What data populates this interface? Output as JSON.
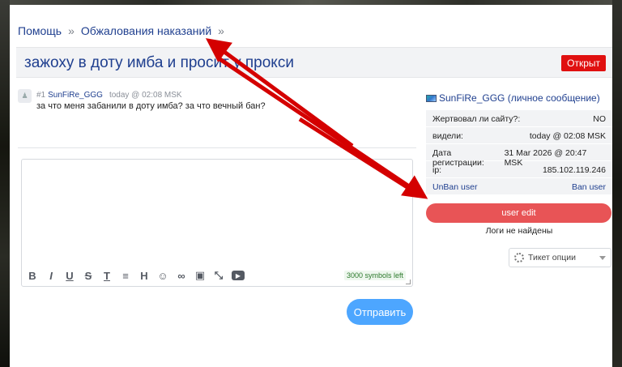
{
  "breadcrumb": {
    "home": "Помощь",
    "sep1": "»",
    "section": "Обжалования наказаний",
    "sep2": "»"
  },
  "thread": {
    "title": "зажоху в доту имба и просит у прокси",
    "status": "Открыт"
  },
  "post": {
    "number": "#1",
    "author": "SunFiRe_GGG",
    "time": "today @ 02:08 MSK",
    "text": "за что меня забанили в доту имба? за что вечный бан?"
  },
  "editor": {
    "counter": "3000 symbols left",
    "tools": [
      "B",
      "I",
      "U",
      "S",
      "T",
      "≡",
      "H",
      "☺",
      "∞",
      "▣",
      "⤡",
      "▶"
    ],
    "tool_icons": [
      "bold-icon",
      "italic-icon",
      "underline-icon",
      "strikethrough-icon",
      "text-clear-icon",
      "list-icon",
      "heading-icon",
      "emoji-icon",
      "link-icon",
      "image-icon",
      "collapse-icon",
      "video-icon"
    ]
  },
  "send_label": "Отправить",
  "sidebar": {
    "user": "SunFiRe_GGG (личное сообщение)",
    "rows": [
      {
        "label": "Жертвовал ли сайту?:",
        "value": "NO"
      },
      {
        "label": "видели:",
        "value": "today @ 02:08 MSK"
      },
      {
        "label": "Дата регистрации:",
        "value": "31 Mar 2026 @ 20:47 MSK"
      },
      {
        "label": "ip:",
        "value": "185.102.119.246"
      }
    ],
    "unban": "UnBan user",
    "ban": "Ban user",
    "user_edit": "user edit",
    "logs": "Логи не найдены",
    "ticket_options": "Тикет опции"
  },
  "colors": {
    "accent": "#1f3f8f",
    "status": "#e01010",
    "send": "#4da6ff",
    "user_edit": "#e85456",
    "arrow": "#d40000"
  }
}
